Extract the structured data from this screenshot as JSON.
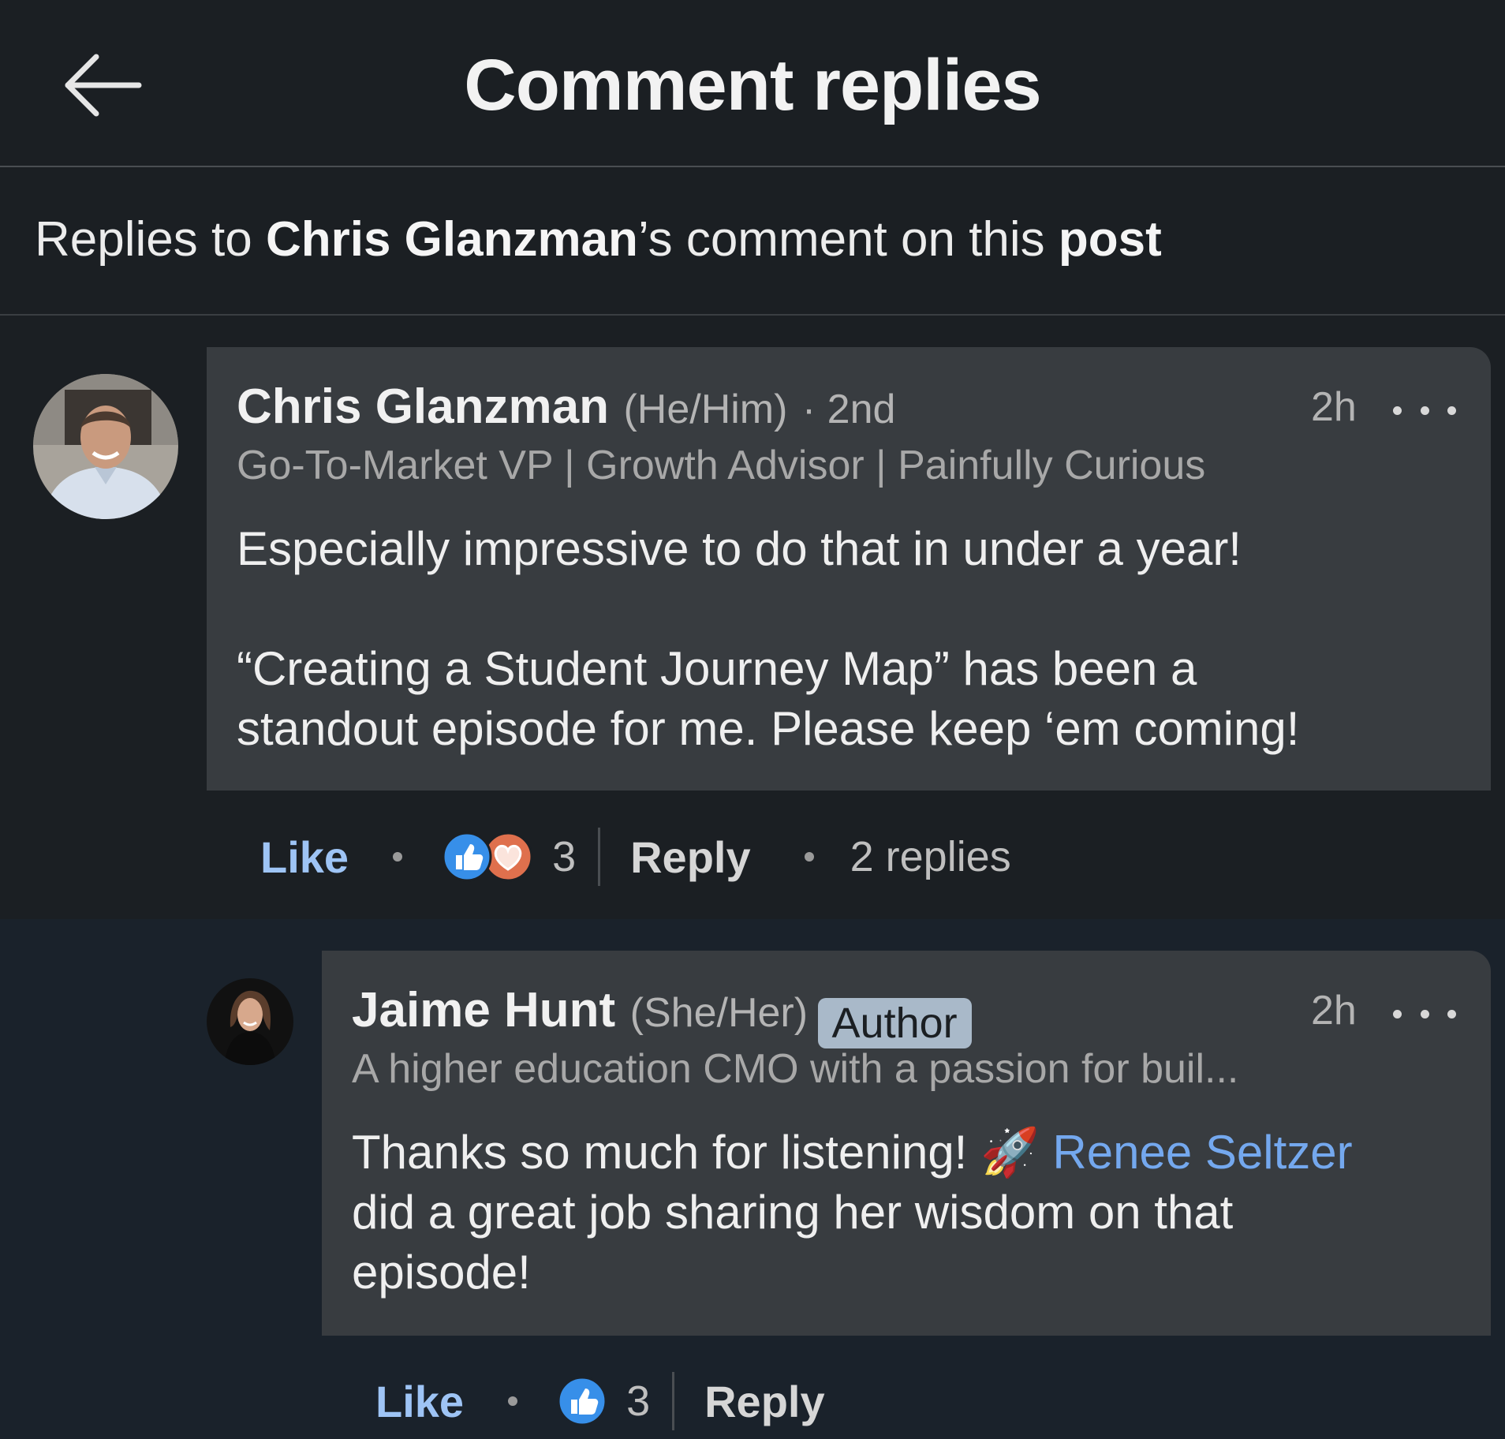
{
  "header": {
    "title": "Comment replies",
    "back_icon": "arrow-left-icon"
  },
  "subheader": {
    "prefix": "Replies to ",
    "author": "Chris Glanzman",
    "middle": "’s comment on this ",
    "post_word": "post"
  },
  "comment": {
    "name": "Chris Glanzman",
    "pronouns": "(He/Him)",
    "degree": "· 2nd",
    "headline": "Go-To-Market VP | Growth Advisor | Painfully Curious",
    "time": "2h",
    "body_line1": "Especially impressive to do that in under a year!",
    "body_line2": "“Creating a Student Journey Map” has been a",
    "body_line3": "standout episode for me. Please keep ‘em coming!",
    "like_label": "Like",
    "reaction_count": "3",
    "reactions": [
      "like-reaction-icon",
      "love-reaction-icon"
    ],
    "reply_label": "Reply",
    "replies_count": "2 replies"
  },
  "reply": {
    "name": "Jaime Hunt",
    "pronouns": "(She/Her)",
    "badge": "Author",
    "headline": "A higher education CMO with a passion for buil...",
    "time": "2h",
    "body_part1": "Thanks so much for listening! ",
    "emoji": "🚀",
    "mention": "Renee Seltzer",
    "body_line2": "did a great job sharing her wisdom on that",
    "body_line3": "episode!",
    "like_label": "Like",
    "reaction_count": "3",
    "reactions": [
      "like-reaction-icon"
    ],
    "reply_label": "Reply"
  },
  "colors": {
    "background": "#1b1f23",
    "reply_background": "#1a222b",
    "bubble": "#383c40",
    "link_blue": "#74a8ee",
    "like_blue": "#9ec4f5",
    "like_reaction": "#378fe9",
    "love_reaction": "#df704d",
    "author_badge": "#a9b9c9"
  }
}
